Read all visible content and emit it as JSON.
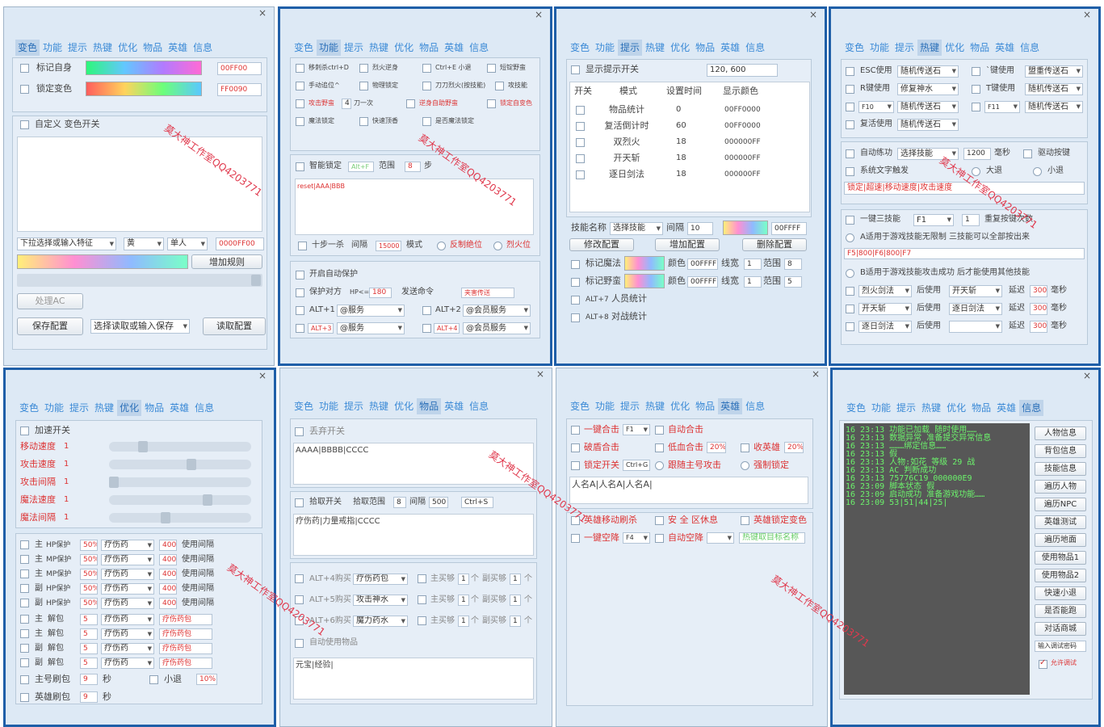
{
  "tabs": [
    "变色",
    "功能",
    "提示",
    "热键",
    "优化",
    "物品",
    "英雄",
    "信息"
  ],
  "close": "×",
  "watermark": "莫大神工作室QQ4203771",
  "p1": {
    "mark_self": "标记自身",
    "mark_self_color": "00FF00",
    "lock_color": "锁定变色",
    "lock_color_val": "FF0090",
    "custom_toggle": "自定义 变色开关",
    "feature_select": "下拉选择或输入特征",
    "color_sel": "黄",
    "single_sel": "单人",
    "rule_color": "0000FF00",
    "add_rule": "增加规则",
    "process_ac": "处理AC",
    "save_cfg": "保存配置",
    "cfg_select": "选择读取或输入保存",
    "read_cfg": "读取配置"
  },
  "p2": {
    "r1a": "移刺杀ctrl+D",
    "r1b": "烈火逆身",
    "r1c": "Ctrl+E 小退",
    "r1d": "短锭野蛮",
    "r2a": "手动追位^",
    "r2b": "物理锁定",
    "r2c": "刀刀烈火(按技能)",
    "r2d": "攻技能",
    "r3a": "攻击野蛮",
    "r3b": "4",
    "r3c": "刀一次",
    "r3d": "逆身自助野蛮",
    "r3e": "锁定自变色",
    "r4a": "魔法锁定",
    "r4b": "快速顶香",
    "r4c": "是否魔法锁定",
    "smart_lock": "智能锁定",
    "smart_key": "Alt+F",
    "range": "范围",
    "range_val": "8",
    "step": "步",
    "reset_text": "reset|AAA|BBB",
    "ten_step": "十步一杀",
    "interval": "间隔",
    "interval_val": "15000",
    "mode": "模式",
    "anti_pos": "反制绝位",
    "fire_pos": "烈火位",
    "auto_protect": "开启自动保护",
    "protect_opp": "保护对方",
    "hp_lte": "HP<=",
    "hp_val": "180",
    "send_cmd": "发送命令",
    "send_val": "夹害传送",
    "alt1": "ALT+1",
    "alt1_sel": "@服务",
    "alt2": "ALT+2",
    "alt2_sel": "@会员服务",
    "alt3": "ALT+3",
    "alt3_sel": "@服务",
    "alt4": "ALT+4",
    "alt4_sel": "@会员服务"
  },
  "p3": {
    "show_hint": "显示提示开关",
    "coords": "120, 600",
    "h_toggle": "开关",
    "h_mode": "模式",
    "h_time": "设置时间",
    "h_color": "显示颜色",
    "rows": [
      [
        "物品统计",
        "0",
        "00FF0000"
      ],
      [
        "复活倒计时",
        "60",
        "00FF0000"
      ],
      [
        "双烈火",
        "18",
        "000000FF"
      ],
      [
        "开天斩",
        "18",
        "000000FF"
      ],
      [
        "逐日剑法",
        "18",
        "000000FF"
      ]
    ],
    "skill_name": "技能名称",
    "skill_sel": "选择技能",
    "gap": "间隔",
    "gap_val": "10",
    "color_val": "00FFFF",
    "modify": "修改配置",
    "add": "增加配置",
    "delete": "删除配置",
    "mark_magic": "标记魔法",
    "color_lbl": "颜色",
    "color1": "00FFFF",
    "line_w": "线宽",
    "lw1": "1",
    "range_lbl": "范围",
    "r1": "8",
    "mark_savage": "标记野蛮",
    "color2": "00FFFF",
    "lw2": "1",
    "r2": "5",
    "alt7": "ALT+7",
    "people_stat": "人员统计",
    "alt8": "ALT+8",
    "fight_stat": "对战统计"
  },
  "p4": {
    "esc_use": "ESC使用",
    "esc_sel": "随机传送石",
    "tilde_use": "`键使用",
    "tilde_sel": "盟重传送石",
    "r_use": "R键使用",
    "r_sel": "修复神水",
    "t_use": "T键使用",
    "t_sel": "随机传送石",
    "f10": "F10",
    "f10_sel": "随机传送石",
    "f11": "F11",
    "f11_sel": "随机传送石",
    "revive_use": "复活使用",
    "revive_sel": "随机传送石",
    "auto_practice": "自动练功",
    "practice_sel": "选择技能",
    "ms_val": "1200",
    "ms": "毫秒",
    "drive_key": "驱动按键",
    "sys_text": "系统文字触发",
    "big_exit": "大退",
    "small_exit": "小退",
    "lock_text": "锁定|超速|移动速度|攻击速度",
    "three_skill": "一键三技能",
    "f1": "F1",
    "one": "1",
    "repeat_times": "重复按键次数",
    "a_desc": "A适用于游戏技能无限制 三技能可以全部按出来",
    "f5_text": "F5|800|F6|800|F7",
    "b_desc": "B适用于游戏技能攻击成功 后才能使用其他技能",
    "c1": "烈火剑法",
    "after_use": "后使用",
    "c1b": "开天斩",
    "delay": "延迟",
    "d1": "300",
    "c2": "开天斩",
    "c2b": "逐日剑法",
    "d2": "300",
    "c3": "逐日剑法",
    "d3": "300"
  },
  "p5": {
    "speed_toggle": "加速开关",
    "move_speed": "移动速度",
    "attack_speed": "攻击速度",
    "attack_interval": "攻击间隔",
    "magic_speed": "魔法速度",
    "magic_interval": "魔法间隔",
    "one": "1",
    "hp": [
      [
        "主",
        "HP保护",
        "50%",
        "疗伤药",
        "400",
        "使用间隔"
      ],
      [
        "主",
        "MP保护",
        "50%",
        "疗伤药",
        "400",
        "使用间隔"
      ],
      [
        "主",
        "MP保护",
        "50%",
        "疗伤药",
        "400",
        "使用间隔"
      ],
      [
        "副",
        "HP保护",
        "50%",
        "疗伤药",
        "400",
        "使用间隔"
      ],
      [
        "副",
        "HP保护",
        "50%",
        "疗伤药",
        "400",
        "使用间隔"
      ]
    ],
    "unpack": [
      [
        "主",
        "解包",
        "5",
        "疗伤药",
        "疗伤药包"
      ],
      [
        "主",
        "解包",
        "5",
        "疗伤药",
        "疗伤药包"
      ],
      [
        "副",
        "解包",
        "5",
        "疗伤药",
        "疗伤药包"
      ],
      [
        "副",
        "解包",
        "5",
        "疗伤药",
        "疗伤药包"
      ]
    ],
    "main_refresh": "主号刷包",
    "nine": "9",
    "sec": "秒",
    "small_exit": "小退",
    "pct": "10%",
    "hero_refresh": "英雄刷包"
  },
  "p6": {
    "discard": "丢弃开关",
    "discard_text": "AAAA|BBBB|CCCC",
    "pickup": "拾取开关",
    "pickup_range": "拾取范围",
    "pr_val": "8",
    "gap": "间隔",
    "gap_val": "500",
    "ctrl_s": "Ctrl+S",
    "pickup_text": "疗伤药|力量戒指|CCCC",
    "buy": [
      [
        "ALT+4购买",
        "疗伤药包"
      ],
      [
        "ALT+5购买",
        "攻击神水"
      ],
      [
        "ALT+6购买",
        "魔力药水"
      ]
    ],
    "main_buy": "主买够",
    "one": "1",
    "unit": "个",
    "sub_buy": "副买够",
    "auto_use": "自动使用物品",
    "auto_text": "元宝|经验|"
  },
  "p7": {
    "combo": "一键合击",
    "f1": "F1",
    "auto_combo": "自动合击",
    "shield_combo": "破盾合击",
    "low_combo": "低血合击",
    "pct20": "20%",
    "recall_hero": "收英雄",
    "pct20b": "20%",
    "lock_toggle": "锁定开关",
    "ctrl_g": "Ctrl+G",
    "follow_attack": "跟随主号攻击",
    "force_lock": "强制锁定",
    "names_text": "人名A|人名A|人名A|",
    "hero_move": "英雄移动刷杀",
    "safe_rest": "安 全 区休息",
    "hero_lock_color": "英雄锁定变色",
    "empty_jump": "一键空降",
    "f4": "F4",
    "auto_jump": "自动空降",
    "heat_key": "热键取目标名称"
  },
  "p8": {
    "log": [
      "16 23:13 功能已加载 随时使用……",
      "16 23:13 数据异常 准备提交异常信息",
      "16 23:13 ………绑定信息……",
      "16 23:13 假",
      "16 23:13 人物:如花  等级 29 战",
      "16 23:13 AC 判断成功",
      "16 23:13 75776C19 000000E9",
      "16 23:09 脚本状态 假",
      "16 23:09 启动成功 准备游戏功能……",
      "16 23:09 53|51|44|25|"
    ],
    "buttons": [
      "人物信息",
      "背包信息",
      "技能信息",
      "遍历人物",
      "遍历NPC",
      "英雄测试",
      "遍历地面",
      "使用物品1",
      "使用物品2",
      "快速小退",
      "是否能跑",
      "对话商城"
    ],
    "input_pw": "输入调试密码",
    "allow": "允许调试"
  }
}
